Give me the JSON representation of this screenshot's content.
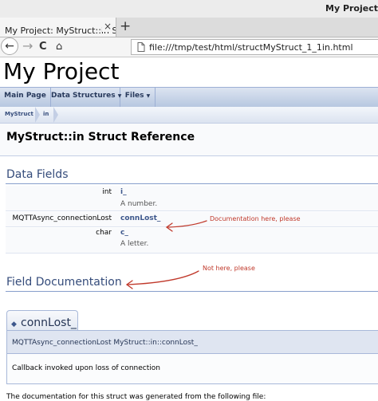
{
  "window": {
    "title": "My Project"
  },
  "tab": {
    "label": "My Project: MyStruct::in Struct",
    "close": "×"
  },
  "newtab": "+",
  "nav": {
    "back": "←",
    "forward": "→",
    "reload": "C",
    "home": "⌂",
    "url": "file:///tmp/test/html/structMyStruct_1_1in.html"
  },
  "project": {
    "title": "My Project"
  },
  "menu": {
    "items": [
      "Main Page",
      "Data Structures",
      "Files"
    ]
  },
  "breadcrumb": [
    "MyStruct",
    "in"
  ],
  "header": {
    "title": "MyStruct::in Struct Reference"
  },
  "data_fields": {
    "heading": "Data Fields",
    "rows": [
      {
        "type": "int",
        "name": "i_",
        "desc": "A number."
      },
      {
        "type": "MQTTAsync_connectionLost",
        "name": "connLost_",
        "desc": ""
      },
      {
        "type": "char",
        "name": "c_",
        "desc": "A letter."
      }
    ]
  },
  "annotations": {
    "doc_here": "Documentation here, please",
    "not_here": "Not here, please",
    "color": "#c0392b"
  },
  "field_doc": {
    "heading": "Field Documentation",
    "member_title": "connLost_",
    "prototype": "MQTTAsync_connectionLost MyStruct::in::connLost_",
    "description": "Callback invoked upon loss of connection"
  },
  "footer": {
    "text": "The documentation for this struct was generated from the following file:"
  }
}
